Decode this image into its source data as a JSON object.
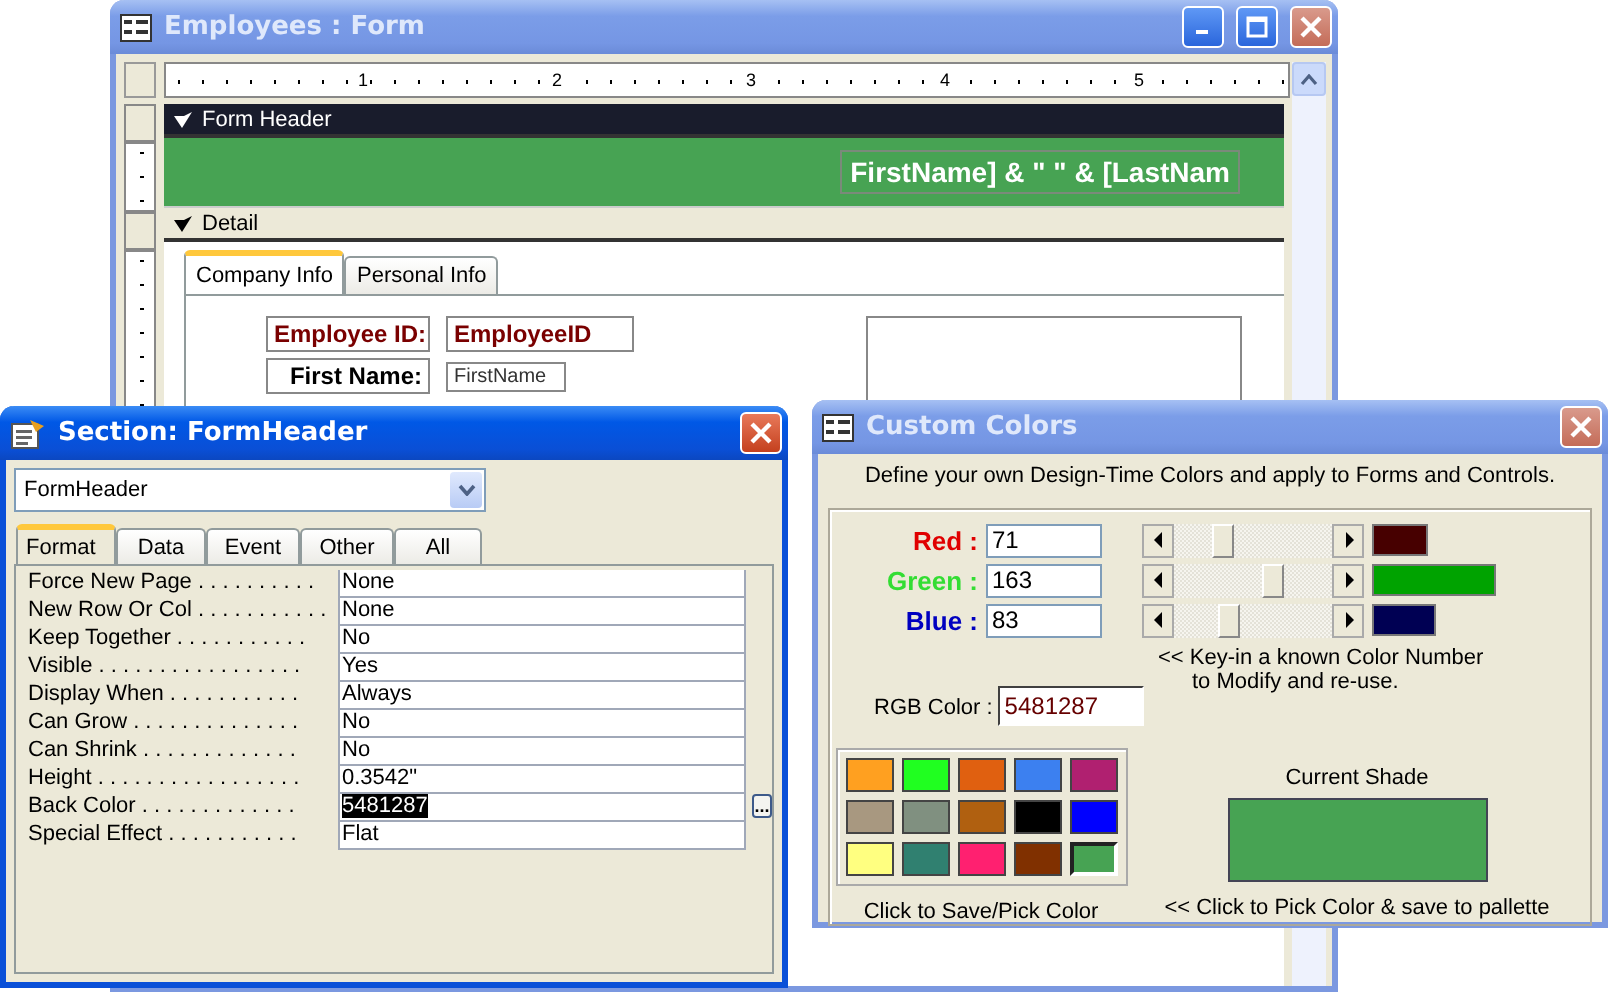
{
  "form_window": {
    "title": "Employees : Form",
    "active": false,
    "ruler": [
      "1",
      "2",
      "3",
      "4",
      "5"
    ],
    "form_header": {
      "label": "Form Header",
      "expression": "FirstName] & \" \" & [LastNam"
    },
    "detail": {
      "label": "Detail",
      "tabs": [
        {
          "label": "Company Info",
          "selected": true
        },
        {
          "label": "Personal Info",
          "selected": false
        }
      ],
      "fields": [
        {
          "label": "Employee ID:",
          "control": "EmployeeID"
        },
        {
          "label": "First Name:",
          "control": "FirstName"
        }
      ]
    }
  },
  "properties_window": {
    "title": "Section: FormHeader",
    "active": true,
    "object": "FormHeader",
    "tabs": [
      {
        "label": "Format",
        "selected": true
      },
      {
        "label": "Data",
        "selected": false
      },
      {
        "label": "Event",
        "selected": false
      },
      {
        "label": "Other",
        "selected": false
      },
      {
        "label": "All",
        "selected": false
      }
    ],
    "builder": "...",
    "properties": [
      {
        "name": "Force New Page . . . . . . . . . .",
        "value": "None",
        "selected": false
      },
      {
        "name": "New Row Or Col . . . . . . . . . . .",
        "value": "None",
        "selected": false
      },
      {
        "name": "Keep Together . . . . . . . . . . .",
        "value": "No",
        "selected": false
      },
      {
        "name": "Visible . . . . . . . . . . . . . . . . .",
        "value": "Yes",
        "selected": false
      },
      {
        "name": "Display When . . . . . . . . . . .",
        "value": "Always",
        "selected": false
      },
      {
        "name": "Can Grow . . . . . . . . . . . . . .",
        "value": "No",
        "selected": false
      },
      {
        "name": "Can Shrink . . . . . . . . . . . . .",
        "value": "No",
        "selected": false
      },
      {
        "name": "Height . . . . . . . . . . . . . . . . .",
        "value": "0.3542\"",
        "selected": false
      },
      {
        "name": "Back Color . . . . . . . . . . . . .",
        "value": "5481287",
        "selected": true
      },
      {
        "name": "Special Effect . . . . . . . . . . .",
        "value": "Flat",
        "selected": false
      }
    ]
  },
  "colors_window": {
    "title": "Custom Colors",
    "active": false,
    "intro": "Define your own Design-Time Colors and apply to Forms and Controls.",
    "channels": [
      {
        "label": "Red :",
        "color": "#e00000",
        "value": "71",
        "level": 0.28,
        "swatch": {
          "color": "#470000"
        }
      },
      {
        "label": "Green :",
        "color": "#33dd33",
        "value": "163",
        "level": 0.64,
        "swatch": {
          "color": "#00a300"
        }
      },
      {
        "label": "Blue :",
        "color": "#0000c0",
        "value": "83",
        "level": 0.33,
        "swatch": {
          "color": "#000053"
        }
      }
    ],
    "hint": [
      "<< Key-in a known Color Number",
      "to Modify and re-use."
    ],
    "rgb": {
      "label": "RGB Color :",
      "value": "5481287"
    },
    "palette": [
      {
        "color": "#ffa020",
        "selected": false
      },
      {
        "color": "#20ff20",
        "selected": false
      },
      {
        "color": "#e06010",
        "selected": false
      },
      {
        "color": "#3c80f0",
        "selected": false
      },
      {
        "color": "#b02070",
        "selected": false
      },
      {
        "color": "#a89880",
        "selected": false
      },
      {
        "color": "#809080",
        "selected": false
      },
      {
        "color": "#b06010",
        "selected": false
      },
      {
        "color": "#000000",
        "selected": false
      },
      {
        "color": "#0000ff",
        "selected": false
      },
      {
        "color": "#ffff80",
        "selected": false
      },
      {
        "color": "#308070",
        "selected": false
      },
      {
        "color": "#ff2070",
        "selected": false
      },
      {
        "color": "#803000",
        "selected": false
      },
      {
        "color": "#47a353",
        "selected": true
      }
    ],
    "palette_caption": "Click to Save/Pick Color",
    "shade": {
      "label": "Current Shade",
      "color": "#47a353",
      "caption": "<< Click to Pick Color & save to pallette"
    }
  }
}
